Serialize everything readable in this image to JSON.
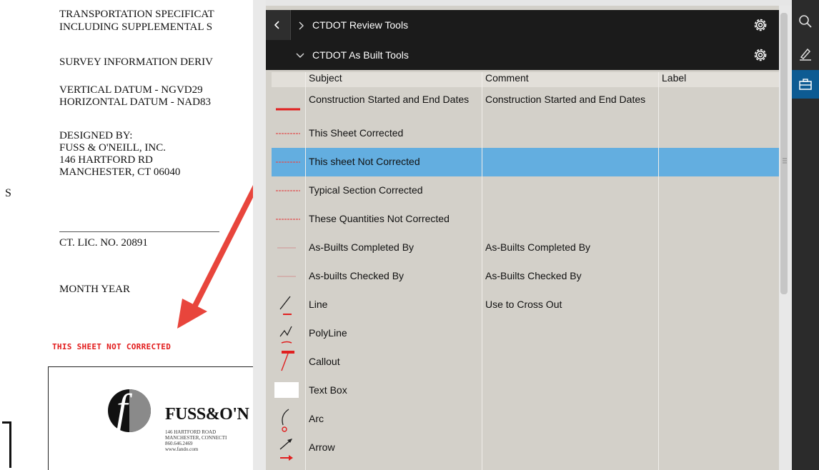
{
  "document": {
    "lines": [
      "TRANSPORTATION SPECIFICAT",
      "INCLUDING SUPPLEMENTAL S",
      "SURVEY INFORMATION DERIV",
      "VERTICAL DATUM - NGVD29",
      "HORIZONTAL DATUM - NAD83",
      "DESIGNED BY:",
      "FUSS & O'NEILL, INC.",
      "146 HARTFORD RD",
      "MANCHESTER, CT  06040",
      "CT. LIC. NO. 20891",
      "MONTH YEAR"
    ],
    "margin_letter": "S",
    "stamp_text": "THIS SHEET NOT CORRECTED",
    "logo": {
      "letter": "f",
      "name": "FUSS&O'N",
      "address": "146 HARTFORD ROAD\nMANCHESTER, CONNECTI\n860.646.2469\nwww.fando.com"
    }
  },
  "panel": {
    "review_tools_title": "CTDOT Review Tools",
    "as_built_title": "CTDOT As Built Tools",
    "columns": [
      "Subject",
      "Comment",
      "Label"
    ],
    "rows": [
      {
        "icon": "red-thick-line-icon",
        "subject": "Construction Started and End Dates",
        "comment": "Construction Started and End Dates",
        "label": ""
      },
      {
        "icon": "red-dashed-line-icon",
        "subject": "This Sheet Corrected",
        "comment": "",
        "label": ""
      },
      {
        "icon": "red-dashed-line-icon",
        "subject": "This sheet Not Corrected",
        "comment": "",
        "label": "",
        "selected": true
      },
      {
        "icon": "red-dashed-line-icon",
        "subject": "Typical Section Corrected",
        "comment": "",
        "label": ""
      },
      {
        "icon": "red-dashed-line-icon",
        "subject": "These Quantities Not Corrected",
        "comment": "",
        "label": ""
      },
      {
        "icon": "faint-line-icon",
        "subject": "As-Builts Completed By",
        "comment": "As-Builts Completed By",
        "label": ""
      },
      {
        "icon": "faint-line-icon",
        "subject": "As-builts Checked By",
        "comment": "As-Builts Checked By",
        "label": ""
      },
      {
        "icon": "line-tool-icon",
        "subject": "Line",
        "comment": "Use to Cross Out",
        "label": ""
      },
      {
        "icon": "polyline-tool-icon",
        "subject": "PolyLine",
        "comment": "",
        "label": ""
      },
      {
        "icon": "callout-tool-icon",
        "subject": "Callout",
        "comment": "",
        "label": ""
      },
      {
        "icon": "text-box-tool-icon",
        "subject": "Text Box",
        "comment": "",
        "label": ""
      },
      {
        "icon": "arc-tool-icon",
        "subject": "Arc",
        "comment": "",
        "label": ""
      },
      {
        "icon": "arrow-tool-icon",
        "subject": "Arrow",
        "comment": "",
        "label": ""
      }
    ]
  },
  "toolbar": {
    "buttons": [
      {
        "icon": "search-icon"
      },
      {
        "icon": "markup-pen-icon"
      },
      {
        "icon": "toolbox-icon",
        "active": true
      }
    ]
  },
  "colors": {
    "selected_row": "#63aee0",
    "panel_bg": "#d3d0c9",
    "header_bg": "#1b1b1b",
    "stamp_red": "#e21b1b",
    "arrow_red": "#e8453c",
    "active_toolbar": "#0d5b93"
  }
}
